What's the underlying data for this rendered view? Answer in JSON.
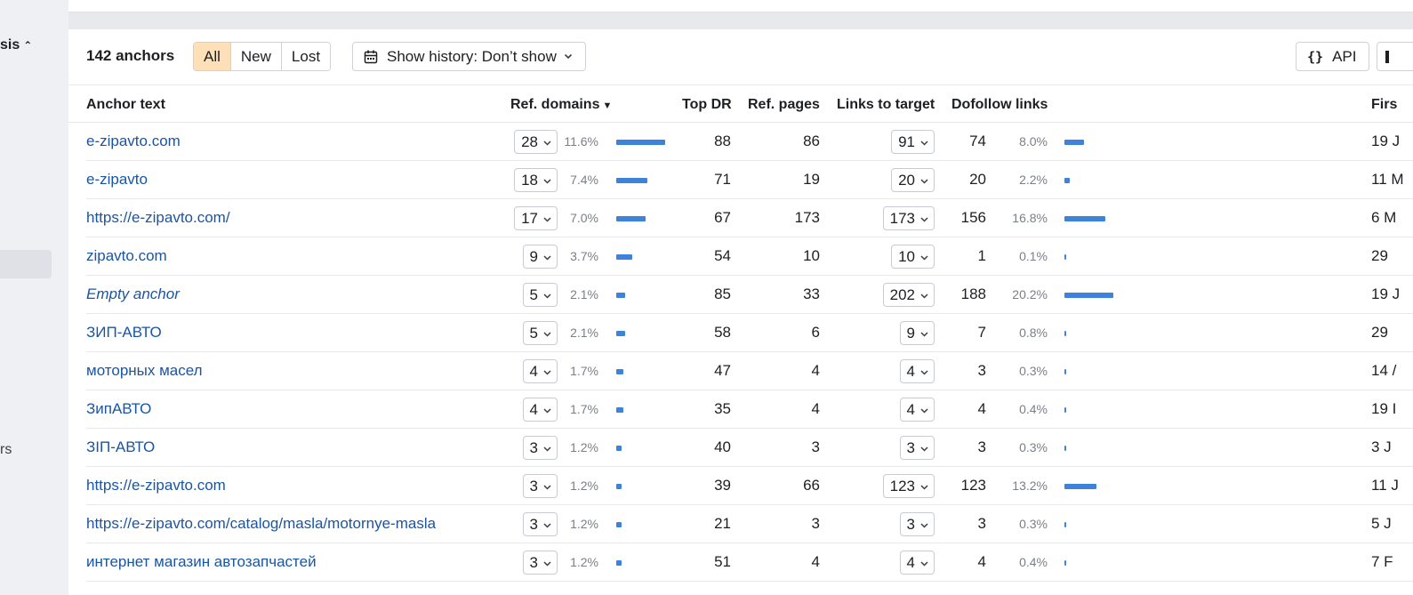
{
  "sidebar": {
    "section_label": "sis",
    "section_chevron": "⌃",
    "bottom_item": "rs"
  },
  "toolbar": {
    "count_label": "142 anchors",
    "filters": [
      "All",
      "New",
      "Lost"
    ],
    "active_filter": "All",
    "history_label": "Show history: Don’t show",
    "api_label": "API",
    "calendar_icon": "calendar-icon"
  },
  "columns": {
    "anchor": "Anchor text",
    "ref_domains": "Ref. domains",
    "top_dr": "Top DR",
    "ref_pages": "Ref. pages",
    "links_to_target": "Links to target",
    "dofollow": "Dofollow links",
    "first_seen": "Firs"
  },
  "rows": [
    {
      "anchor": "e-zipavto.com",
      "italic": false,
      "ref_domains": "28",
      "ref_pct": "11.6%",
      "ref_frac": 0.116,
      "top_dr": "88",
      "ref_pages": "86",
      "links": "91",
      "dofollow": "74",
      "dof_pct": "8.0%",
      "dof_frac": 0.08,
      "first": "19 J"
    },
    {
      "anchor": "e-zipavto",
      "italic": false,
      "ref_domains": "18",
      "ref_pct": "7.4%",
      "ref_frac": 0.074,
      "top_dr": "71",
      "ref_pages": "19",
      "links": "20",
      "dofollow": "20",
      "dof_pct": "2.2%",
      "dof_frac": 0.022,
      "first": "11 M"
    },
    {
      "anchor": "https://e-zipavto.com/",
      "italic": false,
      "ref_domains": "17",
      "ref_pct": "7.0%",
      "ref_frac": 0.07,
      "top_dr": "67",
      "ref_pages": "173",
      "links": "173",
      "dofollow": "156",
      "dof_pct": "16.8%",
      "dof_frac": 0.168,
      "first": "6 M"
    },
    {
      "anchor": "zipavto.com",
      "italic": false,
      "ref_domains": "9",
      "ref_pct": "3.7%",
      "ref_frac": 0.037,
      "top_dr": "54",
      "ref_pages": "10",
      "links": "10",
      "dofollow": "1",
      "dof_pct": "0.1%",
      "dof_frac": 0.001,
      "first": "29"
    },
    {
      "anchor": "Empty anchor",
      "italic": true,
      "ref_domains": "5",
      "ref_pct": "2.1%",
      "ref_frac": 0.021,
      "top_dr": "85",
      "ref_pages": "33",
      "links": "202",
      "dofollow": "188",
      "dof_pct": "20.2%",
      "dof_frac": 0.202,
      "first": "19 J"
    },
    {
      "anchor": "ЗИП-АВТО",
      "italic": false,
      "ref_domains": "5",
      "ref_pct": "2.1%",
      "ref_frac": 0.021,
      "top_dr": "58",
      "ref_pages": "6",
      "links": "9",
      "dofollow": "7",
      "dof_pct": "0.8%",
      "dof_frac": 0.008,
      "first": "29"
    },
    {
      "anchor": "моторных масел",
      "italic": false,
      "ref_domains": "4",
      "ref_pct": "1.7%",
      "ref_frac": 0.017,
      "top_dr": "47",
      "ref_pages": "4",
      "links": "4",
      "dofollow": "3",
      "dof_pct": "0.3%",
      "dof_frac": 0.003,
      "first": "14 /"
    },
    {
      "anchor": "ЗипАВТО",
      "italic": false,
      "ref_domains": "4",
      "ref_pct": "1.7%",
      "ref_frac": 0.017,
      "top_dr": "35",
      "ref_pages": "4",
      "links": "4",
      "dofollow": "4",
      "dof_pct": "0.4%",
      "dof_frac": 0.004,
      "first": "19 I"
    },
    {
      "anchor": "ЗІП-АВТО",
      "italic": false,
      "ref_domains": "3",
      "ref_pct": "1.2%",
      "ref_frac": 0.012,
      "top_dr": "40",
      "ref_pages": "3",
      "links": "3",
      "dofollow": "3",
      "dof_pct": "0.3%",
      "dof_frac": 0.003,
      "first": "3 J"
    },
    {
      "anchor": "https://e-zipavto.com",
      "italic": false,
      "ref_domains": "3",
      "ref_pct": "1.2%",
      "ref_frac": 0.012,
      "top_dr": "39",
      "ref_pages": "66",
      "links": "123",
      "dofollow": "123",
      "dof_pct": "13.2%",
      "dof_frac": 0.132,
      "first": "11 J"
    },
    {
      "anchor": "https://e-zipavto.com/catalog/masla/motornye-masla",
      "italic": false,
      "ref_domains": "3",
      "ref_pct": "1.2%",
      "ref_frac": 0.012,
      "top_dr": "21",
      "ref_pages": "3",
      "links": "3",
      "dofollow": "3",
      "dof_pct": "0.3%",
      "dof_frac": 0.003,
      "first": "5 J"
    },
    {
      "anchor": "интернет магазин автозапчастей",
      "italic": false,
      "ref_domains": "3",
      "ref_pct": "1.2%",
      "ref_frac": 0.012,
      "top_dr": "51",
      "ref_pages": "4",
      "links": "4",
      "dofollow": "4",
      "dof_pct": "0.4%",
      "dof_frac": 0.004,
      "first": "7 F"
    }
  ]
}
